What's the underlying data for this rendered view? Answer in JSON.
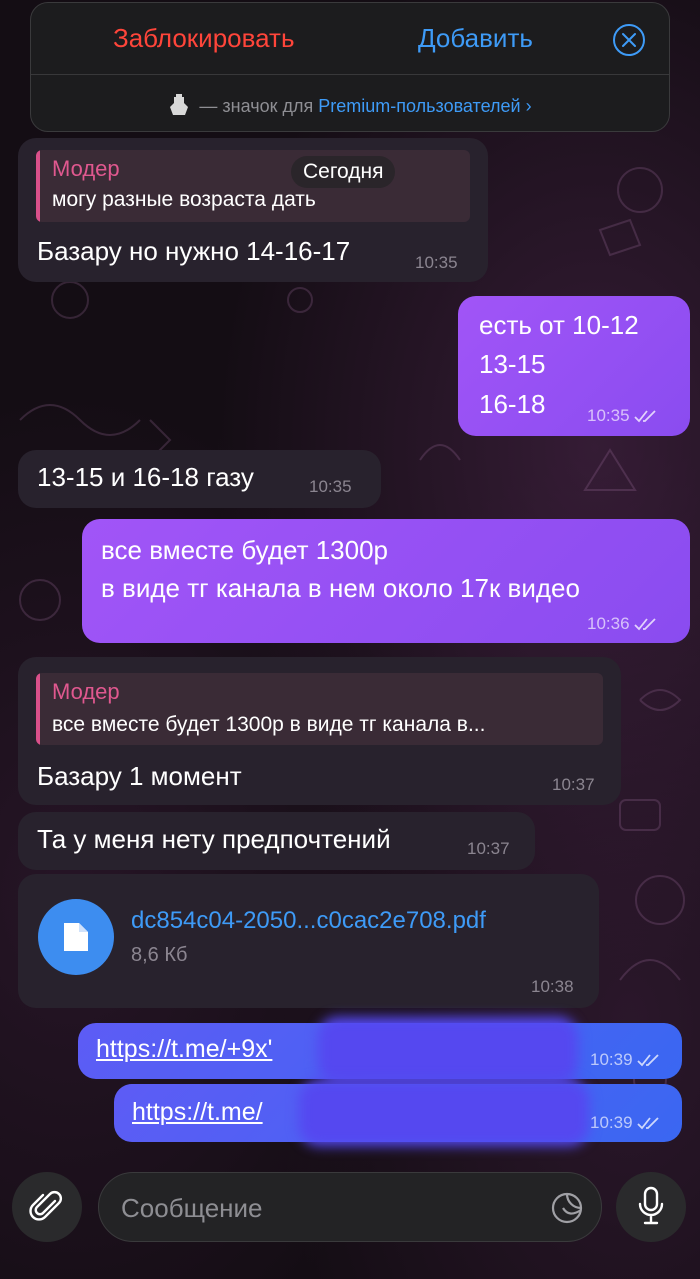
{
  "banner": {
    "block_label": "Заблокировать",
    "add_label": "Добавить",
    "premium_prefix": "— значок для",
    "premium_link": "Premium-пользователей",
    "premium_chevron": "›"
  },
  "date_pill": "Сегодня",
  "messages": [
    {
      "reply_name": "Модер",
      "reply_text": "могу разные возраста дать",
      "text": "Базару но нужно 14-16-17",
      "time": "10:35"
    },
    {
      "lines": [
        "есть от 10-12",
        "13-15",
        "16-18"
      ],
      "time": "10:35"
    },
    {
      "text": "13-15  и 16-18 газу",
      "time": "10:35"
    },
    {
      "lines": [
        "все вместе будет 1300р",
        "в виде тг канала в нем около 17к видео"
      ],
      "time": "10:36"
    },
    {
      "reply_name": "Модер",
      "reply_text": "все вместе будет 1300р в виде тг канала в...",
      "text": "Базару 1 момент",
      "time": "10:37"
    },
    {
      "text": "Та у меня нету предпочтений",
      "time": "10:37"
    },
    {
      "file_name": "dc854c04-2050...c0cac2e708.pdf",
      "file_size": "8,6 Кб",
      "time": "10:38"
    },
    {
      "link": "https://t.me/+9x'",
      "time": "10:39"
    },
    {
      "link": "https://t.me/",
      "time": "10:39"
    }
  ],
  "input": {
    "placeholder": "Сообщение"
  },
  "colors": {
    "accent_blue": "#3e9bf7",
    "block_red": "#ff453a",
    "outgoing_purple": "#9a50f5",
    "outgoing_blue": "#4a62f3",
    "incoming": "#28222d",
    "reply_accent": "#e0588f"
  },
  "icons": [
    "close-icon",
    "premium-badge-icon",
    "chevron-right-icon",
    "read-ticks-icon",
    "document-icon",
    "paperclip-icon",
    "sticker-icon",
    "microphone-icon"
  ]
}
